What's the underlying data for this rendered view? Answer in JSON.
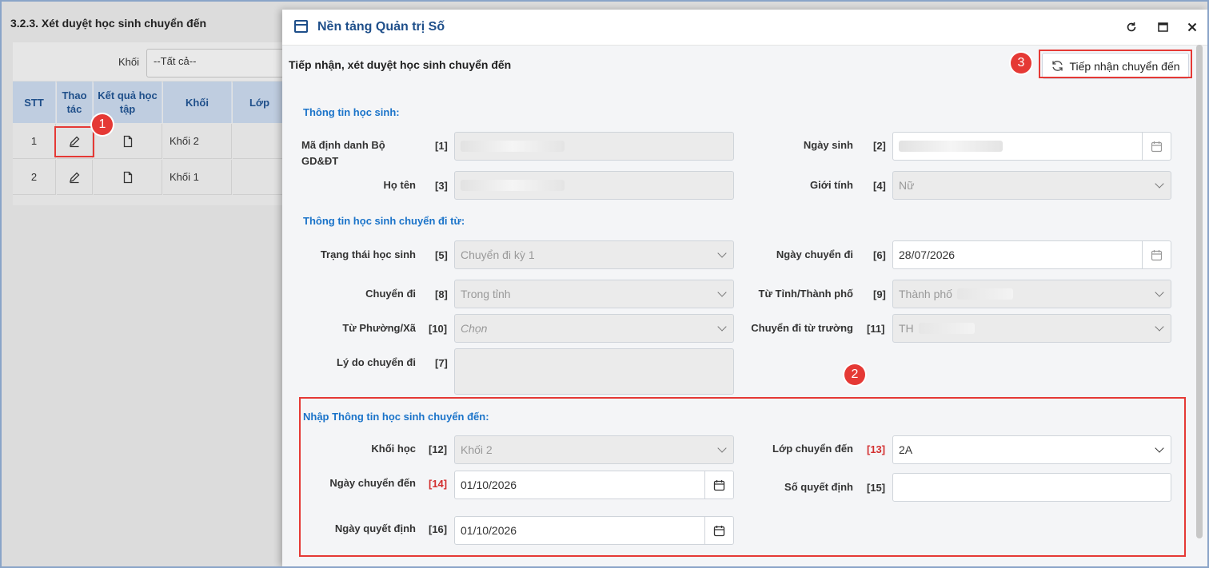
{
  "background": {
    "title": "3.2.3. Xét duyệt học sinh chuyển đến",
    "khoi_label": "Khối",
    "khoi_value": "--Tất cả--",
    "table": {
      "headers": [
        "STT",
        "Thao tác",
        "Kết quả học tập",
        "Khối",
        "Lớp"
      ],
      "rows": [
        {
          "stt": "1",
          "khoi": "Khối 2"
        },
        {
          "stt": "2",
          "khoi": "Khối 1"
        }
      ]
    }
  },
  "callouts": [
    "1",
    "2",
    "3"
  ],
  "modal": {
    "title": "Nền tảng Quản trị Số",
    "subtitle": "Tiếp nhận, xét duyệt học sinh chuyển đến",
    "receive_button": "Tiếp nhận chuyển đến",
    "sections": {
      "student": "Thông tin học sinh:",
      "from": "Thông tin học sinh chuyển đi từ:",
      "to": "Nhập Thông tin học sinh chuyển đến:"
    },
    "fields": {
      "ma_dinh_danh": {
        "label": "Mã định danh Bộ GD&ĐT",
        "num": "[1]"
      },
      "ngay_sinh": {
        "label": "Ngày sinh",
        "num": "[2]"
      },
      "ho_ten": {
        "label": "Họ tên",
        "num": "[3]"
      },
      "gioi_tinh": {
        "label": "Giới tính",
        "num": "[4]",
        "value": "Nữ"
      },
      "trang_thai": {
        "label": "Trạng thái học sinh",
        "num": "[5]",
        "value": "Chuyển đi kỳ 1"
      },
      "ngay_chuyen_di": {
        "label": "Ngày chuyển đi",
        "num": "[6]",
        "value": "28/07/2026"
      },
      "ly_do": {
        "label": "Lý do chuyển đi",
        "num": "[7]"
      },
      "chuyen_di": {
        "label": "Chuyển đi",
        "num": "[8]",
        "value": "Trong tỉnh"
      },
      "tu_tinh": {
        "label": "Từ Tỉnh/Thành phố",
        "num": "[9]",
        "value": "Thành phố"
      },
      "tu_phuong": {
        "label": "Từ Phường/Xã",
        "num": "[10]",
        "value": "Chọn"
      },
      "tu_truong": {
        "label": "Chuyển đi từ trường",
        "num": "[11]",
        "value": "TH"
      },
      "khoi_hoc": {
        "label": "Khối học",
        "num": "[12]",
        "value": "Khối 2"
      },
      "lop_chuyen_den": {
        "label": "Lớp chuyển đến",
        "num": "[13]",
        "value": "2A"
      },
      "ngay_chuyen_den": {
        "label": "Ngày chuyển đến",
        "num": "[14]",
        "value": "01/10/2026"
      },
      "so_quyet_dinh": {
        "label": "Số quyết định",
        "num": "[15]",
        "value": ""
      },
      "ngay_quyet_dinh": {
        "label": "Ngày quyết định",
        "num": "[16]",
        "value": "01/10/2026"
      }
    }
  }
}
